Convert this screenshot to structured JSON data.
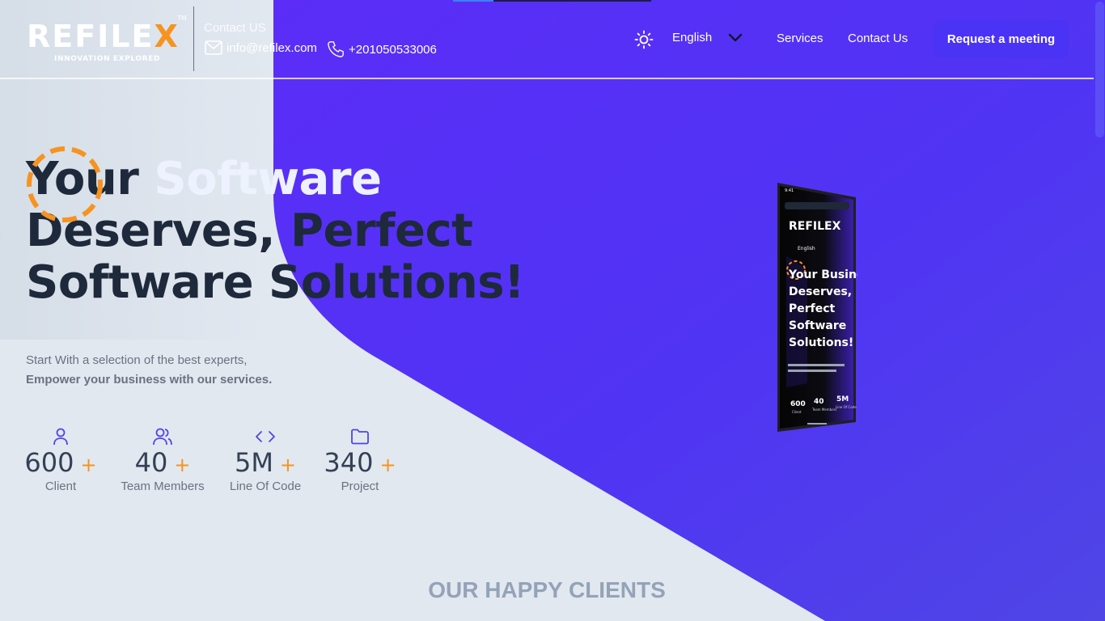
{
  "brand": {
    "logo_text_main": "REFILE",
    "logo_text_x": "X",
    "trademark": "TM",
    "tagline": "INNOVATION EXPLORED",
    "colors": {
      "accent": "#f7931e",
      "primary": "#4a33f5",
      "background": "#e2e8f0"
    }
  },
  "header": {
    "contact_title": "Contact US",
    "email": "info@refilex.com",
    "phone": "+201050533006",
    "language": "English",
    "nav": {
      "services": "Services",
      "contact": "Contact Us"
    },
    "cta": "Request a meeting",
    "icons": {
      "email": "mail-icon",
      "phone": "phone-icon",
      "theme": "sun-icon",
      "language_toggle": "chevron-down-icon"
    }
  },
  "hero": {
    "title_word1": "Your",
    "title_word2": "Software",
    "title_line2": "Deserves, Perfect",
    "title_line3": "Software Solutions!",
    "subtitle": "Start With a selection of the best experts,",
    "subtitle_strong": "Empower your business with our services."
  },
  "stats": [
    {
      "value": "600",
      "plus": "+",
      "label": "Client",
      "icon": "user-icon"
    },
    {
      "value": "40",
      "plus": "+",
      "label": "Team Members",
      "icon": "users-icon"
    },
    {
      "value": "5M",
      "plus": "+",
      "label": "Line Of Code",
      "icon": "code-icon"
    },
    {
      "value": "340",
      "plus": "+",
      "label": "Project",
      "icon": "folder-icon"
    }
  ],
  "phone_mockup": {
    "logo": "REFILEX",
    "language": "English",
    "headline": [
      "Your Business",
      "Deserves,",
      "Perfect",
      "Software",
      "Solutions!"
    ],
    "stats": [
      {
        "value": "600",
        "label": "Client"
      },
      {
        "value": "40",
        "label": "Team Members"
      },
      {
        "value": "5M",
        "label": "Line Of Code"
      }
    ]
  },
  "clients_section": {
    "title": "OUR HAPPY CLIENTS"
  }
}
